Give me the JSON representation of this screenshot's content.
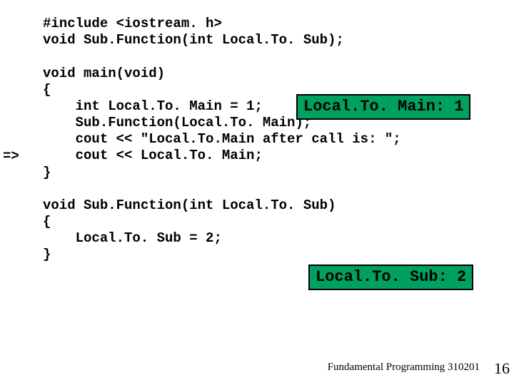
{
  "arrow": "=>",
  "code": "#include <iostream. h>\nvoid Sub.Function(int Local.To. Sub);\n\nvoid main(void)\n{\n    int Local.To. Main = 1;\n    Sub.Function(Local.To. Main);\n    cout << \"Local.To.Main after call is: \";\n    cout << Local.To. Main;\n}\n\nvoid Sub.Function(int Local.To. Sub)\n{\n    Local.To. Sub = 2;\n}",
  "badge_main": "Local.To. Main: 1",
  "badge_sub": "Local.To. Sub: 2",
  "footer": "Fundamental Programming 310201",
  "slide_number": "16"
}
